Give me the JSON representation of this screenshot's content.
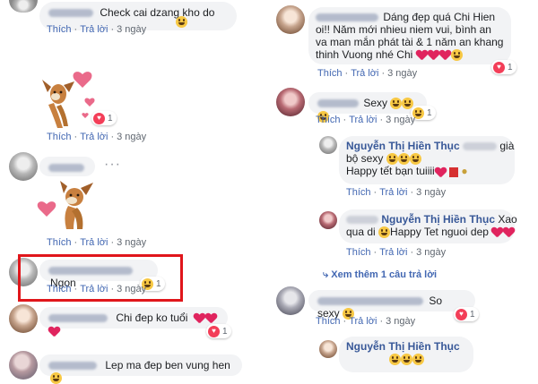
{
  "actions": {
    "like": "Thích",
    "reply": "Trả lời"
  },
  "left": {
    "c1": {
      "text": "Check cai dzang kho do",
      "time": "3 ngày"
    },
    "c2": {
      "time": "3 ngày",
      "react_count": "1"
    },
    "c3": {
      "time": "3 ngày"
    },
    "c4": {
      "text": "Ngon",
      "time": "3 ngày",
      "react_count": "1"
    },
    "c5": {
      "text": "Chi đep ko tuổi",
      "react_count": "1"
    },
    "c6": {
      "text": "Lep ma đep ben vung hen"
    }
  },
  "right": {
    "c1": {
      "text": "Dáng đẹp quá Chi Hien oi!! Năm mới nhieu niem vui, bình an va man mắn phát tài & 1 năm an khang thinh Vuong nhé Chi",
      "time": "3 ngày",
      "react_count": "1"
    },
    "c2": {
      "text": "Sexy",
      "time": "3 ngày",
      "react_count": "1"
    },
    "c3": {
      "author": "Nguyễn Thị Hiền Thục",
      "text1": "già",
      "text2": "bộ sexy",
      "text3": "Happy tết bạn tuiiii",
      "time": "3 ngày"
    },
    "c4": {
      "author": "Nguyễn Thị Hiền Thục",
      "text1": "Xao",
      "text2": "qua di",
      "text3": "Happy Tet nguoi dep",
      "time": "3 ngày"
    },
    "see_more": "Xem thêm 1 câu trả lời",
    "c5": {
      "text": "So sexy",
      "time": "3 ngày",
      "react_count": "1"
    },
    "c6": {
      "author": "Nguyễn Thị Hiền Thục"
    }
  },
  "colors": {
    "accent": "#4267b2",
    "bubble": "#f2f3f5",
    "highlight": "#e0161b",
    "author": "#385898"
  }
}
